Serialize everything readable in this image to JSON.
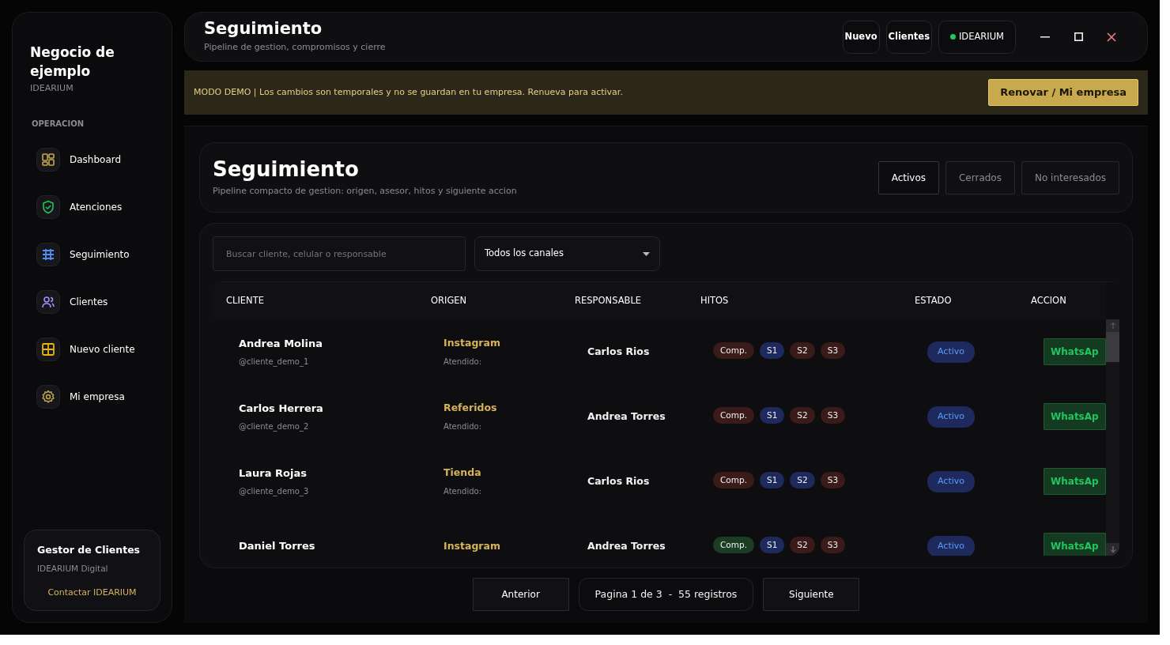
{
  "sidebar": {
    "title": "Negocio de ejemplo",
    "subtitle": "IDEARIUM",
    "section": "OPERACION",
    "items": [
      {
        "label": "Dashboard"
      },
      {
        "label": "Atenciones"
      },
      {
        "label": "Seguimiento"
      },
      {
        "label": "Clientes"
      },
      {
        "label": "Nuevo cliente"
      },
      {
        "label": "Mi empresa"
      }
    ],
    "footer": {
      "title": "Gestor de Clientes",
      "subtitle": "IDEARIUM Digital",
      "link": "Contactar IDEARIUM"
    }
  },
  "header": {
    "title": "Seguimiento",
    "subtitle": "Pipeline de gestion, compromisos y cierre",
    "buttons": [
      "Nuevo",
      "Clientes"
    ],
    "account": {
      "label": "IDEARIUM",
      "online": true
    }
  },
  "banner": {
    "text": "MODO DEMO | Los cambios son temporales y no se guardan en tu empresa. Renueva para activar.",
    "button": "Renovar / Mi empresa"
  },
  "panel": {
    "title": "Seguimiento",
    "subtitle": "Pipeline compacto de gestion: origen, asesor, hitos y siguiente accion",
    "tabs": [
      {
        "label": "Activos",
        "selected": true
      },
      {
        "label": "Cerrados",
        "selected": false
      },
      {
        "label": "No interesados",
        "selected": false
      }
    ]
  },
  "filters": {
    "search": {
      "placeholder": "Buscar cliente, celular o responsable"
    },
    "channel": "Todos los canales"
  },
  "table": {
    "columns": [
      "CLIENTE",
      "ORIGEN",
      "RESPONSABLE",
      "HITOS",
      "ESTADO",
      "ACCION"
    ],
    "rows": [
      {
        "name": "Andrea Molina",
        "handle": "@cliente_demo_1",
        "origin": "Instagram",
        "attended": "Atendido:",
        "owner": "Carlos Rios",
        "milestones": [
          {
            "label": "Comp.",
            "color": "#3b1a1a"
          },
          {
            "label": "S1",
            "color": "#1e2a5e"
          },
          {
            "label": "S2",
            "color": "#3b1a1a"
          },
          {
            "label": "S3",
            "color": "#3b1a1a"
          }
        ],
        "status": "Activo",
        "action": "WhatsAp"
      },
      {
        "name": "Carlos Herrera",
        "handle": "@cliente_demo_2",
        "origin": "Referidos",
        "attended": "Atendido:",
        "owner": "Andrea Torres",
        "milestones": [
          {
            "label": "Comp.",
            "color": "#3b1a1a"
          },
          {
            "label": "S1",
            "color": "#1e2a5e"
          },
          {
            "label": "S2",
            "color": "#3b1a1a"
          },
          {
            "label": "S3",
            "color": "#3b1a1a"
          }
        ],
        "status": "Activo",
        "action": "WhatsAp"
      },
      {
        "name": "Laura Rojas",
        "handle": "@cliente_demo_3",
        "origin": "Tienda",
        "attended": "Atendido:",
        "owner": "Carlos Rios",
        "milestones": [
          {
            "label": "Comp.",
            "color": "#3b1a1a"
          },
          {
            "label": "S1",
            "color": "#1e2a5e"
          },
          {
            "label": "S2",
            "color": "#1e2a5e"
          },
          {
            "label": "S3",
            "color": "#3b1a1a"
          }
        ],
        "status": "Activo",
        "action": "WhatsAp"
      },
      {
        "name": "Daniel Torres",
        "origin": "Instagram",
        "owner": "Andrea Torres",
        "milestones": [
          {
            "label": "Comp.",
            "color": "#1a3d24"
          },
          {
            "label": "S1",
            "color": "#1e2a5e"
          },
          {
            "label": "S2",
            "color": "#3b1a1a"
          },
          {
            "label": "S3",
            "color": "#3b1a1a"
          }
        ],
        "status": "Activo",
        "action": "WhatsAp"
      }
    ]
  },
  "pagination": {
    "previous": "Anterior",
    "info": "Pagina 1 de 3  -  55 registros",
    "next": "Siguiente"
  }
}
